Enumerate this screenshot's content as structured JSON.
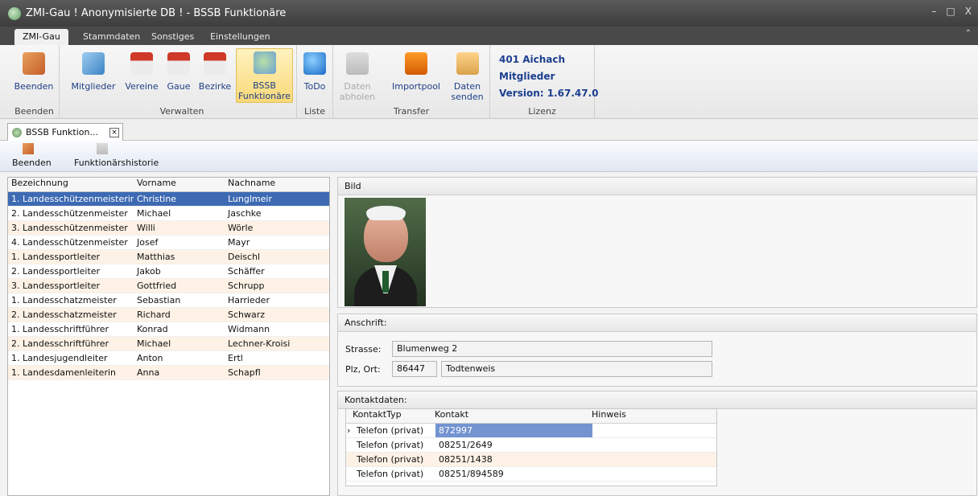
{
  "window": {
    "title": "ZMI-Gau ! Anonymisierte DB ! - BSSB Funktionäre",
    "controls": [
      "–",
      "□",
      "X"
    ]
  },
  "ribbon_tabs": [
    "ZMI-Gau",
    "Stammdaten",
    "Sonstiges",
    "Einstellungen"
  ],
  "ribbon_groups": {
    "beenden": {
      "label": "Beenden",
      "buttons": [
        "Beenden"
      ]
    },
    "verwalten": {
      "label": "Verwalten",
      "buttons": [
        "Mitglieder",
        "Vereine",
        "Gaue",
        "Bezirke",
        "BSSB Funktionäre"
      ]
    },
    "liste": {
      "label": "Liste",
      "buttons": [
        "ToDo"
      ]
    },
    "transfer": {
      "label": "Transfer",
      "buttons": [
        "Daten abholen",
        "Importpool",
        "Daten senden"
      ]
    },
    "lizenz": {
      "label": "Lizenz",
      "lines": [
        "401 Aichach",
        "Mitglieder",
        "Version: 1.67.47.0"
      ]
    }
  },
  "doc_tab": {
    "label": "BSSB Funktion..."
  },
  "toolbar": {
    "beenden": "Beenden",
    "history": "Funktionärshistorie"
  },
  "left_table": {
    "headers": [
      "Bezeichnung",
      "Vorname",
      "Nachname"
    ],
    "rows": [
      [
        "1. Landesschützenmeisterin",
        "Christine",
        "Lunglmeir"
      ],
      [
        "2. Landesschützenmeister",
        "Michael",
        "Jaschke"
      ],
      [
        "3. Landesschützenmeister",
        "Willi",
        "Wörle"
      ],
      [
        "4. Landesschützenmeister",
        "Josef",
        "Mayr"
      ],
      [
        "1. Landessportleiter",
        "Matthias",
        "Deischl"
      ],
      [
        "2. Landessportleiter",
        "Jakob",
        "Schäffer"
      ],
      [
        "3. Landessportleiter",
        "Gottfried",
        "Schrupp"
      ],
      [
        "1. Landesschatzmeister",
        "Sebastian",
        "Harrieder"
      ],
      [
        "2. Landesschatzmeister",
        "Richard",
        "Schwarz"
      ],
      [
        "1. Landesschriftführer",
        "Konrad",
        "Widmann"
      ],
      [
        "2. Landesschriftführer",
        "Michael",
        "Lechner-Kroisi"
      ],
      [
        "1. Landesjugendleiter",
        "Anton",
        "Ertl"
      ],
      [
        "1. Landesdamenleiterin",
        "Anna",
        "Schapfl"
      ]
    ]
  },
  "bild": {
    "label": "Bild"
  },
  "anschrift": {
    "label": "Anschrift:",
    "strasse_label": "Strasse:",
    "strasse": "Blumenweg 2",
    "plz_label": "Plz, Ort:",
    "plz": "86447",
    "ort": "Todtenweis"
  },
  "kontakt": {
    "label": "Kontaktdaten:",
    "headers": [
      "KontaktTyp",
      "Kontakt",
      "Hinweis"
    ],
    "rows": [
      [
        "Telefon (privat)",
        "872997",
        ""
      ],
      [
        "Telefon (privat)",
        "08251/2649",
        ""
      ],
      [
        "Telefon (privat)",
        "08251/1438",
        ""
      ],
      [
        "Telefon (privat)",
        "08251/894589",
        ""
      ]
    ]
  },
  "colors": {
    "titlebar": "#4a4a4a",
    "selection": "#3d6ab3",
    "alt_row": "#fdf2e5",
    "ribbon_selected": "#fbe29a"
  }
}
